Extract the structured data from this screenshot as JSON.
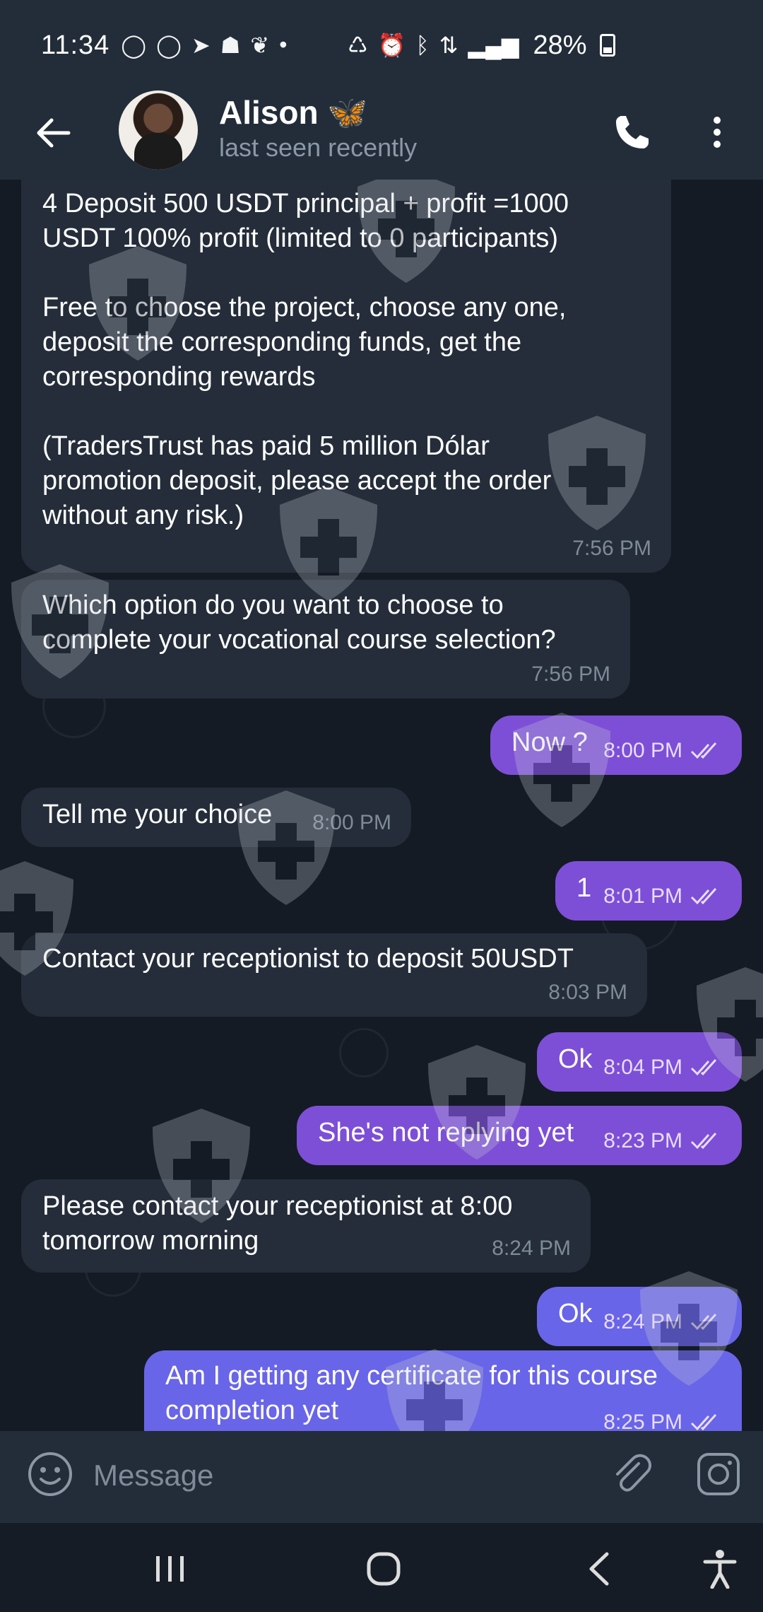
{
  "status_bar": {
    "time": "11:34",
    "battery": "28%",
    "notification_icons": [
      "whatsapp-icon",
      "whatsapp-icon",
      "telegram-icon",
      "snapchat-icon",
      "butterfly-icon",
      "dot-icon"
    ],
    "system_icons": [
      "recycle-icon",
      "alarm-icon",
      "bluetooth-icon",
      "data-icon",
      "signal-icon"
    ]
  },
  "header": {
    "name": "Alison 🦋",
    "status": "last seen recently"
  },
  "messages": [
    {
      "dir": "in",
      "text": "4 Deposit 500 USDT principal + profit =1000\nUSDT 100% profit (limited to 0 participants)\n\nFree to choose the project, choose any one,\ndeposit the corresponding funds, get the\ncorresponding rewards\n\n(TradersTrust has paid 5 million Dólar\npromotion deposit, please accept the order\nwithout any risk.)",
      "time": "7:56 PM"
    },
    {
      "dir": "in",
      "text": "Which option do you want to choose to\ncomplete your vocational course selection?",
      "time": "7:56 PM"
    },
    {
      "dir": "out",
      "text": "Now ?",
      "time": "8:00 PM"
    },
    {
      "dir": "in",
      "text": "Tell me your choice",
      "time": "8:00 PM"
    },
    {
      "dir": "out",
      "text": "1",
      "time": "8:01 PM"
    },
    {
      "dir": "in",
      "text": "Contact your receptionist to deposit 50USDT",
      "time": "8:03 PM"
    },
    {
      "dir": "out",
      "text": "Ok",
      "time": "8:04 PM"
    },
    {
      "dir": "out",
      "text": "She's not replying yet",
      "time": "8:23 PM"
    },
    {
      "dir": "in",
      "text": "Please contact your receptionist at 8:00\ntomorrow morning",
      "time": "8:24 PM"
    },
    {
      "dir": "out",
      "text": "Ok",
      "time": "8:24 PM"
    },
    {
      "dir": "out",
      "text": "Am I getting any certificate for this course\ncompletion yet",
      "time": "8:25 PM"
    }
  ],
  "composer": {
    "placeholder": "Message"
  },
  "colors": {
    "background": "#141b24",
    "header": "#232d39",
    "incoming_bubble": "#242d39",
    "outgoing_bubble": "#7d4fd6",
    "outgoing_bubble_latest": "#6965e8",
    "muted_text": "#8a98a8"
  }
}
